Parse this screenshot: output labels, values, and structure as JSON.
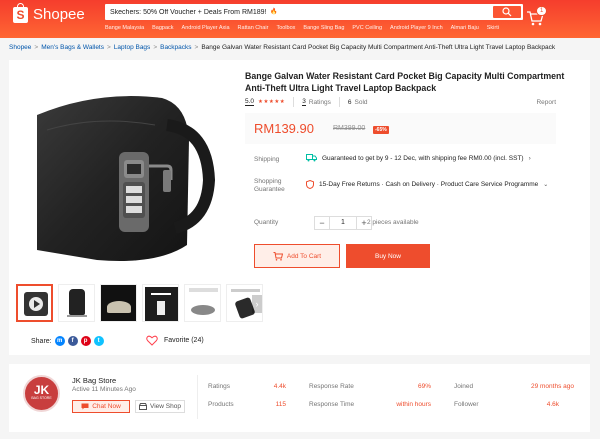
{
  "header": {
    "logo_text": "Shopee",
    "search_value": "Skechers: 50% Off Voucher + Deals From RM189!",
    "search_emoji": "🔥",
    "suggestions": [
      "Bange Malaysia",
      "Bagpack",
      "Android Player Axia",
      "Rattan Chair",
      "Toolbox",
      "Bange Sling Bag",
      "PVC Ceiling",
      "Android Player 9 Inch",
      "Almari Baju",
      "Skirti"
    ],
    "cart_count": "1"
  },
  "breadcrumb": {
    "items": [
      "Shopee",
      "Men's Bags & Wallets",
      "Laptop Bags",
      "Backpacks"
    ],
    "current": "Bange Galvan Water Resistant Card Pocket Big Capacity Multi Compartment Anti-Theft Ultra Light Travel Laptop Backpack",
    "separator": ">"
  },
  "product": {
    "title": "Bange Galvan Water Resistant Card Pocket Big Capacity Multi Compartment Anti-Theft Ultra Light Travel Laptop Backpack",
    "rating": "5.0",
    "stars": "★★★★★",
    "ratings_count": "3",
    "ratings_label": "Ratings",
    "sold_count": "6",
    "sold_label": "Sold",
    "report_label": "Report",
    "price": "RM139.90",
    "original_price": "RM399.00",
    "discount": "-65%",
    "shipping_label": "Shipping",
    "shipping_text": "Guaranteed to get by 9 - 12 Dec, with shipping fee RM0.00 (incl. SST)",
    "guarantee_label_1": "Shopping",
    "guarantee_label_2": "Guarantee",
    "guarantee_text": "15-Day Free Returns · Cash on Delivery · Product Care Service Programme",
    "quantity_label": "Quantity",
    "quantity_value": "1",
    "minus": "−",
    "plus": "+",
    "availability": "2 pieces available",
    "add_to_cart": "Add To Cart",
    "buy_now": "Buy Now",
    "share_label": "Share:",
    "favorite_label": "Favorite (24)"
  },
  "shop": {
    "avatar_text": "JK",
    "avatar_sub": "BAG STORE",
    "name": "JK Bag Store",
    "active": "Active 11 Minutes Ago",
    "chat_label": "Chat Now",
    "view_label": "View Shop",
    "stats": [
      {
        "label": "Ratings",
        "value": "4.4k"
      },
      {
        "label": "Response Rate",
        "value": "69%"
      },
      {
        "label": "Joined",
        "value": "29 months ago"
      },
      {
        "label": "Products",
        "value": "115"
      },
      {
        "label": "Response Time",
        "value": "within hours"
      },
      {
        "label": "Follower",
        "value": "4.6k"
      }
    ]
  },
  "colors": {
    "brand": "#ee4d2d",
    "link": "#0055aa"
  }
}
